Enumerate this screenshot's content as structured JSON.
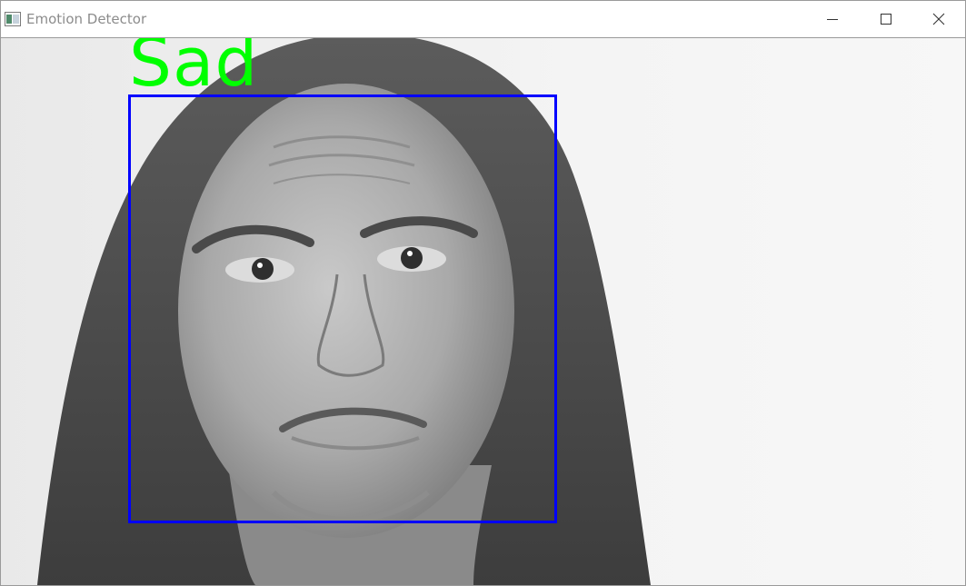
{
  "window": {
    "title": "Emotion Detector"
  },
  "controls": {
    "minimize": "minimize",
    "maximize": "maximize",
    "close": "close"
  },
  "detection": {
    "label": "Sad",
    "box_color": "#0000ff",
    "label_color": "#00ff00"
  },
  "video": {
    "content": "grayscale-face-image"
  }
}
